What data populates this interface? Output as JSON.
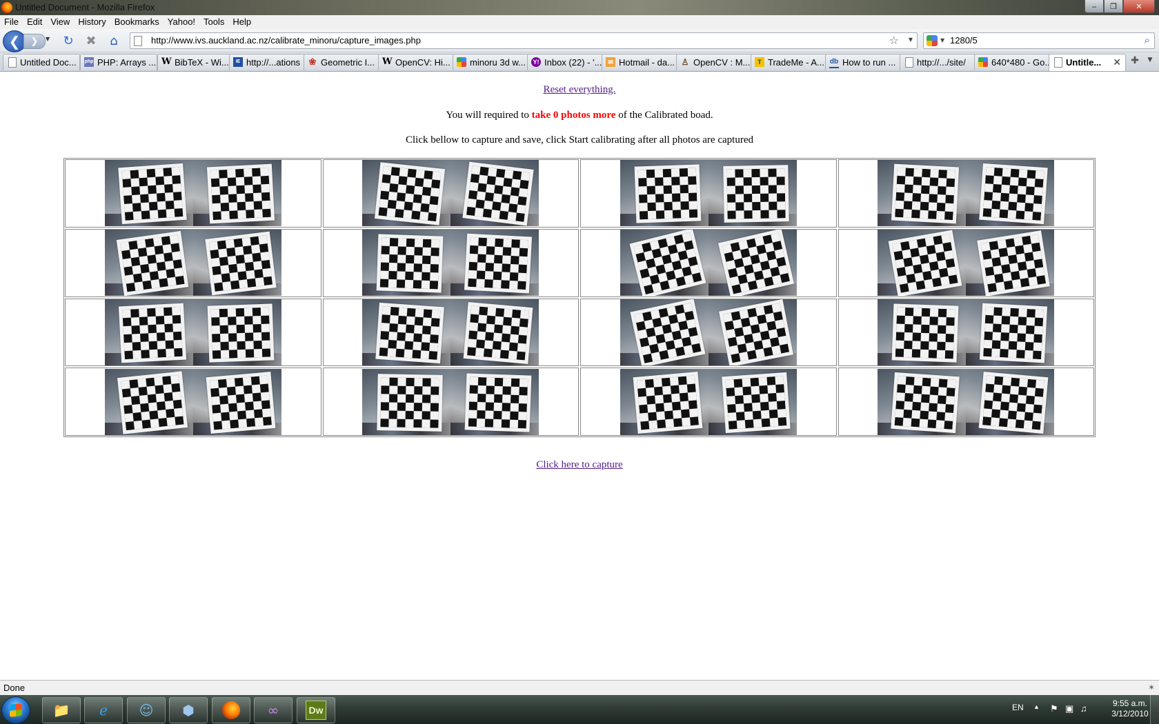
{
  "window": {
    "title": "Untitled Document - Mozilla Firefox"
  },
  "menu": [
    "File",
    "Edit",
    "View",
    "History",
    "Bookmarks",
    "Yahoo!",
    "Tools",
    "Help"
  ],
  "navigation": {
    "url": "http://www.ivs.auckland.ac.nz/calibrate_minoru/capture_images.php",
    "search_value": "1280/5"
  },
  "tabs": [
    {
      "label": "Untitled Doc...",
      "icon": "doc-icon"
    },
    {
      "label": "PHP: Arrays ...",
      "icon": "php-icon"
    },
    {
      "label": "BibTeX - Wi...",
      "icon": "wikipedia-icon"
    },
    {
      "label": "http://...ations",
      "icon": "ieee-icon"
    },
    {
      "label": "Geometric I...",
      "icon": "geometric-icon"
    },
    {
      "label": "OpenCV: Hi...",
      "icon": "wikipedia-icon"
    },
    {
      "label": "minoru 3d w...",
      "icon": "google-icon"
    },
    {
      "label": "Inbox (22) - '...",
      "icon": "yahoo-icon"
    },
    {
      "label": "Hotmail - da...",
      "icon": "mail-icon"
    },
    {
      "label": "OpenCV : M...",
      "icon": "opencv-icon"
    },
    {
      "label": "TradeMe - A...",
      "icon": "trademe-icon"
    },
    {
      "label": "How to run ...",
      "icon": "db-icon"
    },
    {
      "label": "http://.../site/",
      "icon": "doc-icon"
    },
    {
      "label": "640*480 - Go...",
      "icon": "google-icon"
    },
    {
      "label": "Untitle...",
      "icon": "doc-icon",
      "active": true
    }
  ],
  "page": {
    "reset_link": "Reset everything.",
    "required_prefix": "You will required to ",
    "required_emphasis": "take 0 photos more",
    "required_suffix": " of the Calibrated boad.",
    "instruction": "Click bellow to capture and save, click Start calibrating after all photos are captured",
    "capture_link": "Click here to capture",
    "photo_pairs": 16
  },
  "status": {
    "text": "Done"
  },
  "taskbar": {
    "language": "EN",
    "time": "9:55 a.m.",
    "date": "3/12/2010"
  }
}
